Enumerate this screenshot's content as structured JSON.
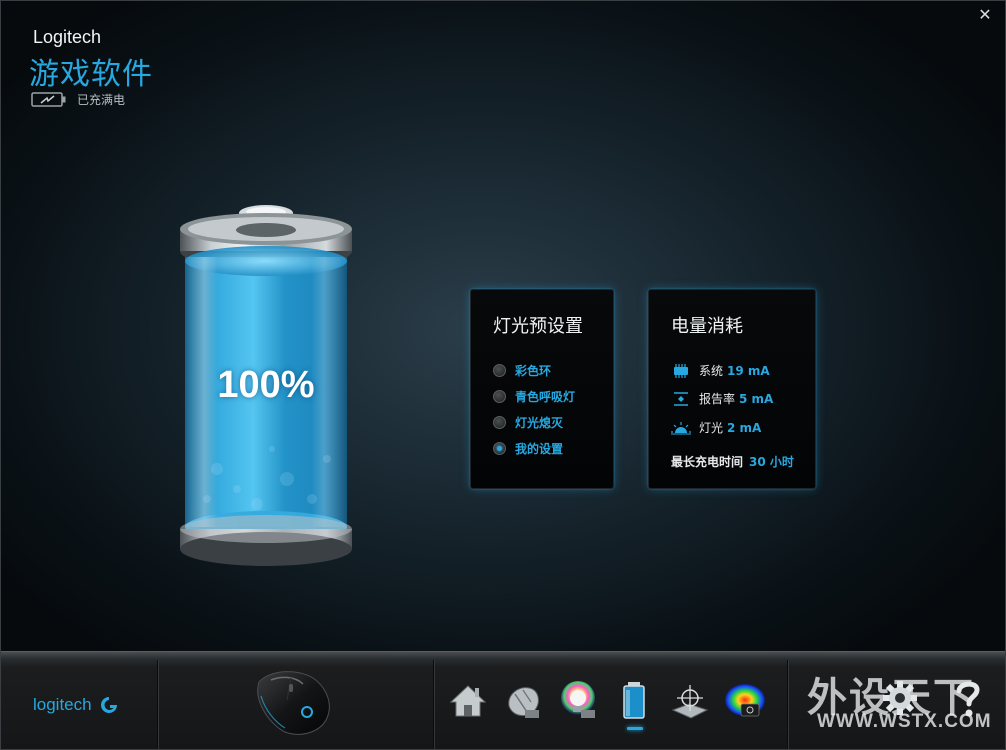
{
  "window": {
    "close_label": "✕"
  },
  "header": {
    "brand": "Logitech",
    "title": "游戏软件",
    "status_icon": "battery-charged-icon",
    "status_text": "已充满电"
  },
  "battery": {
    "percent_label": "100%",
    "level": 1.0
  },
  "lighting_panel": {
    "title": "灯光预设置",
    "options": [
      {
        "label": "彩色环",
        "selected": false
      },
      {
        "label": "青色呼吸灯",
        "selected": false
      },
      {
        "label": "灯光熄灭",
        "selected": false
      },
      {
        "label": "我的设置",
        "selected": true
      }
    ]
  },
  "power_panel": {
    "title": "电量消耗",
    "rows": [
      {
        "icon": "system-chip-icon",
        "label": "系统",
        "value": "19 mA"
      },
      {
        "icon": "report-rate-icon",
        "label": "报告率",
        "value": "5 mA"
      },
      {
        "icon": "light-sun-icon",
        "label": "灯光",
        "value": "2 mA"
      }
    ],
    "charge_label": "最长充电时间",
    "charge_value": "30 小时"
  },
  "bottom_bar": {
    "logo_text": "logitech",
    "nav": [
      {
        "icon": "home-icon",
        "active": false
      },
      {
        "icon": "mouse-customize-icon",
        "active": false
      },
      {
        "icon": "lighting-bulb-icon",
        "active": false
      },
      {
        "icon": "battery-icon",
        "active": true
      },
      {
        "icon": "sensor-target-icon",
        "active": false
      },
      {
        "icon": "heatmap-icon",
        "active": false
      }
    ],
    "settings_icon": "gear-icon",
    "help_icon": "help-icon"
  },
  "watermark": {
    "cn": "外设天下",
    "url": "WWW.WSTX.COM"
  },
  "colors": {
    "accent": "#27a8e0",
    "background": "#0d1a21",
    "panel": "#050607"
  }
}
